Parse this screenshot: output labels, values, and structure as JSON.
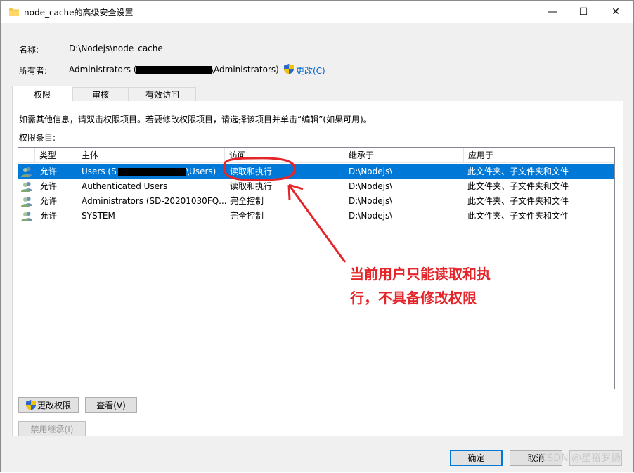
{
  "window": {
    "title": "node_cache的高级安全设置",
    "controls": {
      "minimize": "—",
      "maximize": "☐",
      "close": "✕"
    }
  },
  "info": {
    "name_label": "名称:",
    "name_value": "D:\\Nodejs\\node_cache",
    "owner_label": "所有者:",
    "owner_prefix": "Administrators (",
    "owner_suffix": "\\Administrators)",
    "change_link": "更改(C)"
  },
  "tabs": [
    {
      "label": "权限",
      "active": true
    },
    {
      "label": "审核",
      "active": false
    },
    {
      "label": "有效访问",
      "active": false
    }
  ],
  "permissions": {
    "instruction": "如需其他信息，请双击权限项目。若要修改权限项目，请选择该项目并单击“编辑”(如果可用)。",
    "entries_label": "权限条目:",
    "columns": [
      "类型",
      "主体",
      "访问",
      "继承于",
      "应用于"
    ],
    "rows": [
      {
        "type": "允许",
        "principal": "Users (S",
        "principal_suffix": "\\Users)",
        "access": "读取和执行",
        "inherited": "D:\\Nodejs\\",
        "applies": "此文件夹、子文件夹和文件",
        "selected": true
      },
      {
        "type": "允许",
        "principal": "Authenticated Users",
        "principal_suffix": "",
        "access": "读取和执行",
        "inherited": "D:\\Nodejs\\",
        "applies": "此文件夹、子文件夹和文件",
        "selected": false
      },
      {
        "type": "允许",
        "principal": "Administrators (SD-20201030FQ...",
        "principal_suffix": "",
        "access": "完全控制",
        "inherited": "D:\\Nodejs\\",
        "applies": "此文件夹、子文件夹和文件",
        "selected": false
      },
      {
        "type": "允许",
        "principal": "SYSTEM",
        "principal_suffix": "",
        "access": "完全控制",
        "inherited": "D:\\Nodejs\\",
        "applies": "此文件夹、子文件夹和文件",
        "selected": false
      }
    ]
  },
  "buttons": {
    "change_permissions": "更改权限",
    "view": "查看(V)",
    "disable_inheritance": "禁用继承(I)",
    "ok": "确定",
    "cancel": "取消"
  },
  "annotation": {
    "line1": "当前用户只能读取和执",
    "line2": "行，不具备修改权限",
    "color": "#e4262b"
  },
  "watermark": "CSDN @星裕罗扬",
  "colors": {
    "selection": "#0078d7",
    "link": "#0066cc"
  },
  "icons": [
    "folder-icon",
    "uac-shield-icon",
    "user-group-icon"
  ]
}
